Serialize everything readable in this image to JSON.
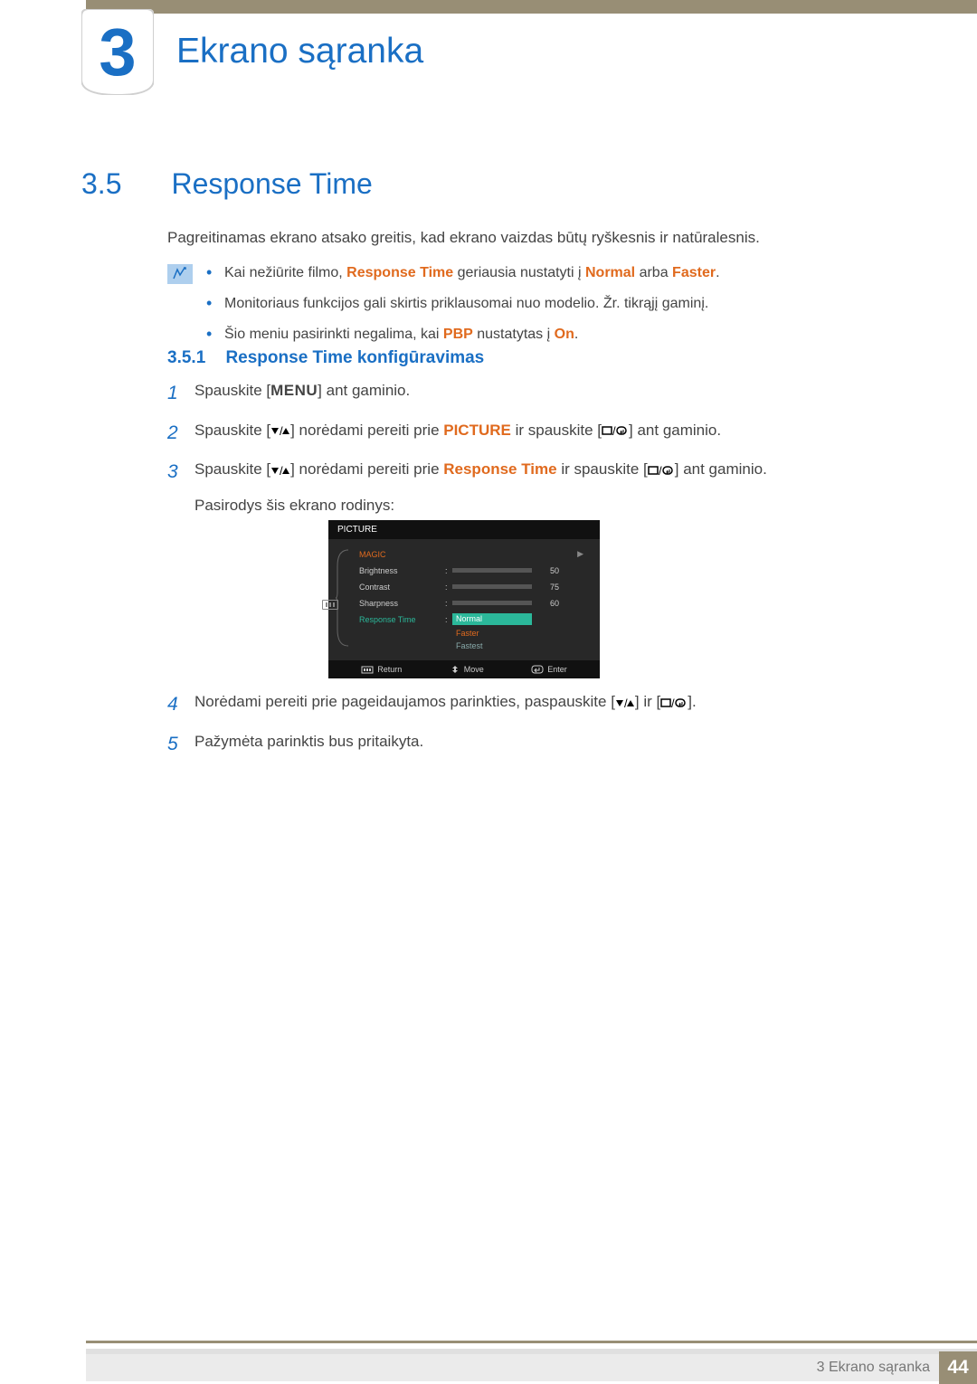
{
  "chapter": {
    "number": "3",
    "title": "Ekrano sąranka"
  },
  "section": {
    "number": "3.5",
    "title": "Response Time"
  },
  "intro": "Pagreitinamas ekrano atsako greitis, kad ekrano vaizdas būtų ryškesnis ir natūralesnis.",
  "bullets": {
    "b1_pre": "Kai nežiūrite filmo, ",
    "b1_rt": "Response Time",
    "b1_mid": " geriausia nustatyti į ",
    "b1_normal": "Normal",
    "b1_or": " arba ",
    "b1_faster": "Faster",
    "b1_end": ".",
    "b2": "Monitoriaus funkcijos gali skirtis priklausomai nuo modelio. Žr. tikrąjį gaminį.",
    "b3_pre": "Šio meniu pasirinkti negalima, kai ",
    "b3_pbp": "PBP",
    "b3_mid": " nustatytas į ",
    "b3_on": "On",
    "b3_end": "."
  },
  "subsection": {
    "number": "3.5.1",
    "title": "Response Time konfigūravimas"
  },
  "steps": {
    "s1_pre": "Spauskite [",
    "s1_menu": "MENU",
    "s1_post": "] ant gaminio.",
    "s2_pre": "Spauskite [",
    "s2_mid1": "] norėdami pereiti prie ",
    "s2_pic": "PICTURE",
    "s2_mid2": " ir spauskite [",
    "s2_post": "] ant gaminio.",
    "s3_pre": "Spauskite [",
    "s3_mid1": "] norėdami pereiti prie ",
    "s3_rt": "Response Time",
    "s3_mid2": " ir spauskite [",
    "s3_post": "] ant gaminio.",
    "s3_extra": "Pasirodys šis ekrano rodinys:",
    "s4_pre": "Norėdami pereiti prie pageidaujamos parinkties, paspauskite [",
    "s4_mid": "] ir [",
    "s4_post": "].",
    "s5": "Pažymėta parinktis bus pritaikyta."
  },
  "step_nums": {
    "n1": "1",
    "n2": "2",
    "n3": "3",
    "n4": "4",
    "n5": "5"
  },
  "osd": {
    "title": "PICTURE",
    "rows": {
      "magic": "MAGIC",
      "brightness": "Brightness",
      "contrast": "Contrast",
      "sharpness": "Sharpness",
      "response": "Response Time"
    },
    "values": {
      "brightness": "50",
      "contrast": "75",
      "sharpness": "60"
    },
    "options": {
      "normal": "Normal",
      "faster": "Faster",
      "fastest": "Fastest"
    },
    "footer": {
      "return": "Return",
      "move": "Move",
      "enter": "Enter"
    }
  },
  "footer": {
    "text": "3 Ekrano sąranka",
    "page": "44"
  },
  "chart_data": {
    "type": "bar",
    "title": "PICTURE",
    "categories": [
      "Brightness",
      "Contrast",
      "Sharpness"
    ],
    "values": [
      50,
      75,
      60
    ],
    "ylim": [
      0,
      100
    ],
    "options": [
      "Normal",
      "Faster",
      "Fastest"
    ],
    "selected_option": "Normal"
  }
}
